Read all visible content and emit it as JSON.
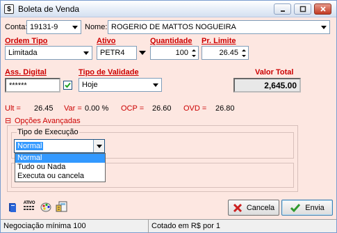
{
  "window": {
    "title": "Boleta de Venda"
  },
  "conta": {
    "label": "Conta:",
    "value": "19131-9"
  },
  "nome": {
    "label": "Nome:",
    "value": "ROGERIO DE MATTOS NOGUEIRA"
  },
  "ordem_tipo": {
    "label": "Ordem Tipo",
    "value": "Limitada"
  },
  "ativo": {
    "label": "Ativo",
    "value": "PETR4"
  },
  "quantidade": {
    "label": "Quantidade",
    "value": "100"
  },
  "pr_limite": {
    "label": "Pr. Limite",
    "value": "26.45"
  },
  "ass_digital": {
    "label": "Ass. Digital",
    "value": "******"
  },
  "tipo_validade": {
    "label": "Tipo de Validade",
    "value": "Hoje"
  },
  "valor_total": {
    "label": "Valor Total",
    "value": "2,645.00"
  },
  "quotes": {
    "ult_label": "Ult =",
    "ult_value": "26.45",
    "var_label": "Var =",
    "var_value": "0.00 %",
    "ocp_label": "OCP =",
    "ocp_value": "26.60",
    "ovd_label": "OVD =",
    "ovd_value": "26.80"
  },
  "opcoes": {
    "toggle": "⊟",
    "label": "Opções Avançadas",
    "tipo_execucao_label": "Tipo de Execução",
    "tipo_execucao_value": "Normal",
    "options": [
      "Normal",
      "Tudo ou Nada",
      "Executa ou cancela"
    ]
  },
  "toolbar_icons": {
    "ativo_text": "ATIVO"
  },
  "buttons": {
    "cancel": "Cancela",
    "send": "Envia"
  },
  "status": {
    "left": "Negociação mínima 100",
    "right": "Cotado em R$ por 1"
  },
  "colors": {
    "background": "#fde7e1",
    "label_red": "#cc0000",
    "selection_blue": "#3399ff",
    "send_green": "#2e9a2e",
    "cancel_red": "#cc2020"
  }
}
